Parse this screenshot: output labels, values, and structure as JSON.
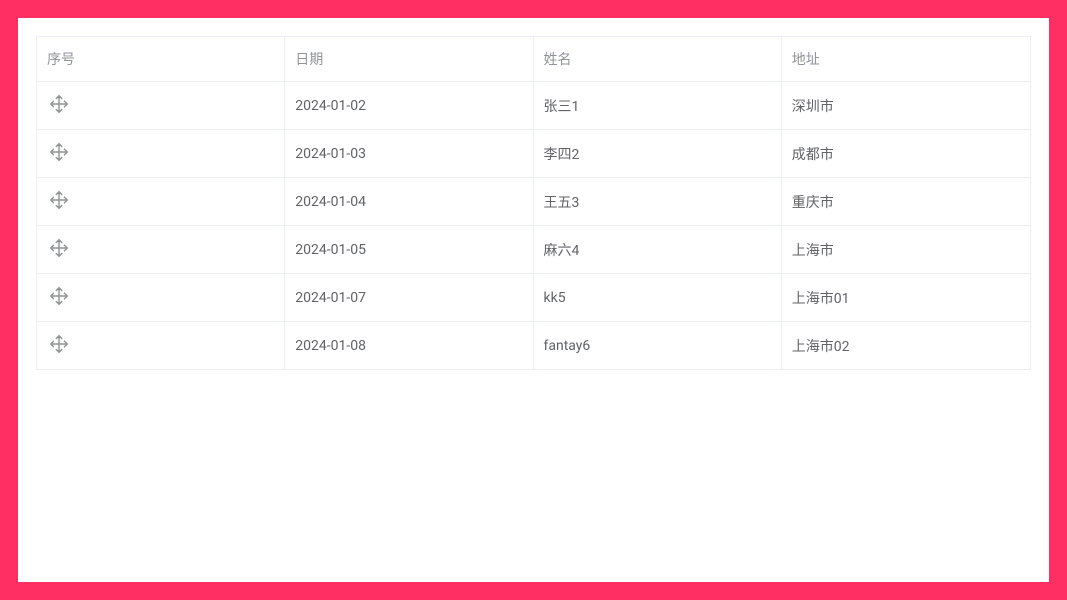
{
  "table": {
    "headers": {
      "index": "序号",
      "date": "日期",
      "name": "姓名",
      "address": "地址"
    },
    "rows": [
      {
        "date": "2024-01-02",
        "name": "张三1",
        "address": "深圳市"
      },
      {
        "date": "2024-01-03",
        "name": "李四2",
        "address": "成都市"
      },
      {
        "date": "2024-01-04",
        "name": "王五3",
        "address": "重庆市"
      },
      {
        "date": "2024-01-05",
        "name": "麻六4",
        "address": "上海市"
      },
      {
        "date": "2024-01-07",
        "name": "kk5",
        "address": "上海市01"
      },
      {
        "date": "2024-01-08",
        "name": "fantay6",
        "address": "上海市02"
      }
    ]
  },
  "colors": {
    "accent": "#ff2e63",
    "border": "#ebeef5",
    "text": "#606266",
    "muted": "#909399"
  }
}
